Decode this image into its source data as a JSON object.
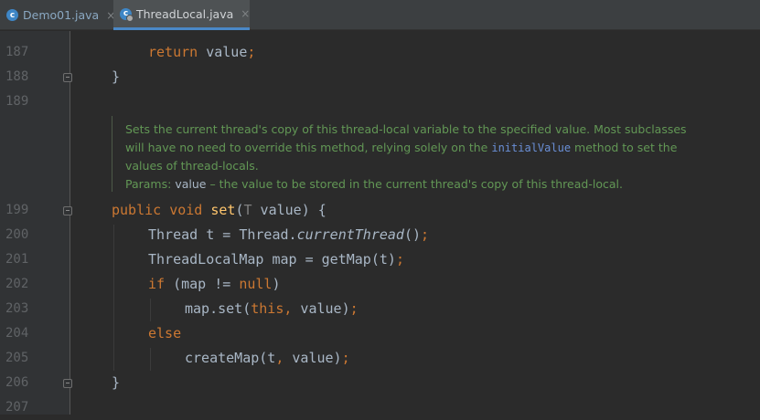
{
  "tabs": [
    {
      "label": "Demo01.java",
      "icon": "java-class-icon",
      "active": false
    },
    {
      "label": "ThreadLocal.java",
      "icon": "java-class-locked-icon",
      "active": true
    }
  ],
  "close_glyph": "×",
  "gutter": {
    "line_numbers": [
      "187",
      "188",
      "189",
      "199",
      "200",
      "201",
      "202",
      "203",
      "204",
      "205",
      "206",
      "207"
    ]
  },
  "code": {
    "l187": {
      "kw": "return",
      "text": " value",
      "semi": ";"
    },
    "l188": "}",
    "l199": {
      "kw1": "public",
      "kw2": "void",
      "name": "set",
      "open": "(",
      "type": "T",
      "param": " value) {"
    },
    "l200": {
      "a": "Thread t = Thread.",
      "call": "currentThread",
      "b": "()",
      "semi": ";"
    },
    "l201": {
      "a": "ThreadLocalMap map = getMap(t)",
      "semi": ";"
    },
    "l202": {
      "kw": "if",
      "a": " (map != ",
      "kw2": "null",
      "b": ")"
    },
    "l203": {
      "a": "map.set(",
      "kw": "this",
      "comma": ",",
      "b": " value)",
      "semi": ";"
    },
    "l204": {
      "kw": "else"
    },
    "l205": {
      "a": "createMap(t",
      "comma": ",",
      "b": " value)",
      "semi": ";"
    },
    "l206": "}"
  },
  "doc": {
    "line1": "Sets the current thread's copy of this thread-local variable to the specified value. Most subclasses",
    "line2a": "will have no need to override this method, relying solely on the ",
    "line2code": "initialValue",
    "line2b": " method to set the",
    "line3": "values of thread-locals.",
    "params_label": "Params: ",
    "params_name": "value",
    "params_desc": " – the value to be stored in the current thread's copy of this thread-local."
  }
}
